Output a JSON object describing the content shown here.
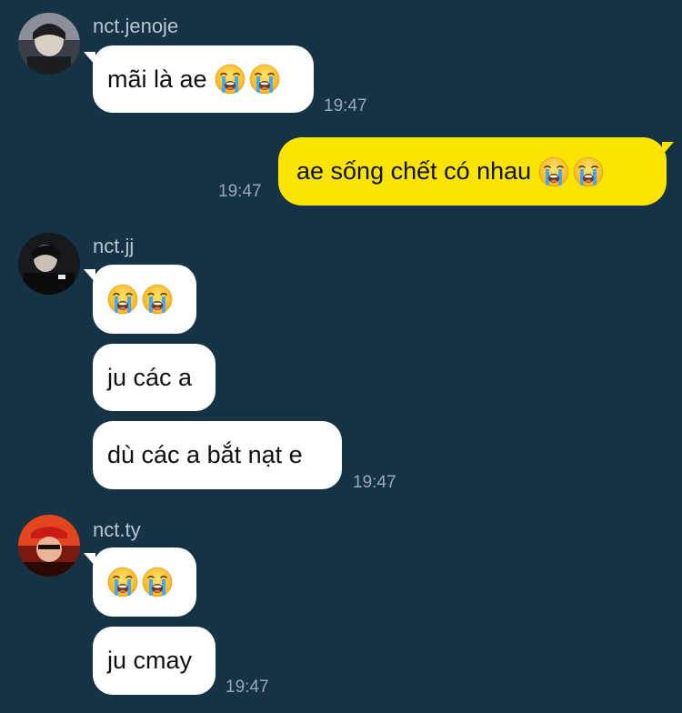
{
  "screen": {
    "background": "#163346",
    "incoming_bubble_color": "#ffffff",
    "outgoing_bubble_color": "#fbe500"
  },
  "messages": [
    {
      "sender": "nct.jenoje",
      "text": "mãi là ae",
      "emoji": "loudly-crying-face x2",
      "time": "19:47"
    },
    {
      "sender": "me",
      "text": "ae sống chết có nhau",
      "emoji": "loudly-crying-face x2",
      "time": "19:47"
    },
    {
      "sender": "nct.jj",
      "bubbles": [
        {
          "text": "",
          "emoji": "loudly-crying-face x2"
        },
        {
          "text": "ju các a"
        },
        {
          "text": "dù các a bắt nạt e"
        }
      ],
      "time": "19:47"
    },
    {
      "sender": "nct.ty",
      "bubbles": [
        {
          "text": "",
          "emoji": "loudly-crying-face x2"
        },
        {
          "text": "ju cmay"
        }
      ],
      "time": "19:47"
    }
  ],
  "group1": {
    "name": "nct.jenoje",
    "msg": "mãi là ae",
    "time": "19:47"
  },
  "group2": {
    "msg": "ae sống chết có nhau",
    "time": "19:47"
  },
  "group3": {
    "name": "nct.jj",
    "msg2": "ju các a",
    "msg3": "dù các a bắt nạt e",
    "time": "19:47"
  },
  "group4": {
    "name": "nct.ty",
    "msg2": "ju cmay",
    "time": "19:47"
  }
}
